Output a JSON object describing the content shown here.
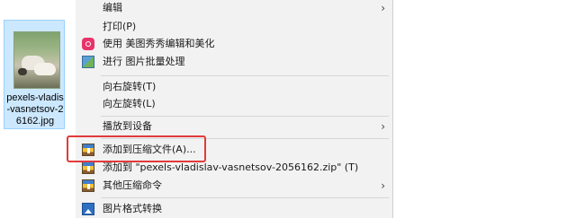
{
  "file": {
    "name": "pexels-vladislav-vasnetsov-2056162.jpg",
    "name_lines": [
      "pexels-vladis",
      "-vasnetsov-2",
      "6162.jpg"
    ]
  },
  "menu": {
    "items": [
      {
        "label": "编辑",
        "icon": "",
        "has_submenu": true
      },
      {
        "label": "打印(P)",
        "icon": "",
        "has_submenu": false
      },
      {
        "label": "使用 美图秀秀编辑和美化",
        "icon": "meitu-icon",
        "has_submenu": false
      },
      {
        "label": "进行 图片批量处理",
        "icon": "batch-process-icon",
        "has_submenu": false
      },
      {
        "label": "向右旋转(T)",
        "icon": "",
        "has_submenu": false
      },
      {
        "label": "向左旋转(L)",
        "icon": "",
        "has_submenu": false
      },
      {
        "label": "播放到设备",
        "icon": "",
        "has_submenu": true
      },
      {
        "label": "添加到压缩文件(A)...",
        "icon": "archive-icon",
        "has_submenu": false
      },
      {
        "label": "添加到 \"pexels-vladislav-vasnetsov-2056162.zip\" (T)",
        "icon": "archive-icon",
        "has_submenu": false
      },
      {
        "label": "其他压缩命令",
        "icon": "archive-icon",
        "has_submenu": true
      },
      {
        "label": "图片格式转换",
        "icon": "image-convert-icon",
        "has_submenu": false
      }
    ],
    "submenu_arrow": "›"
  },
  "colors": {
    "menu_bg": "#f2f2f2",
    "selection_bg": "#cce8ff",
    "highlight_border": "#e23a3a"
  }
}
